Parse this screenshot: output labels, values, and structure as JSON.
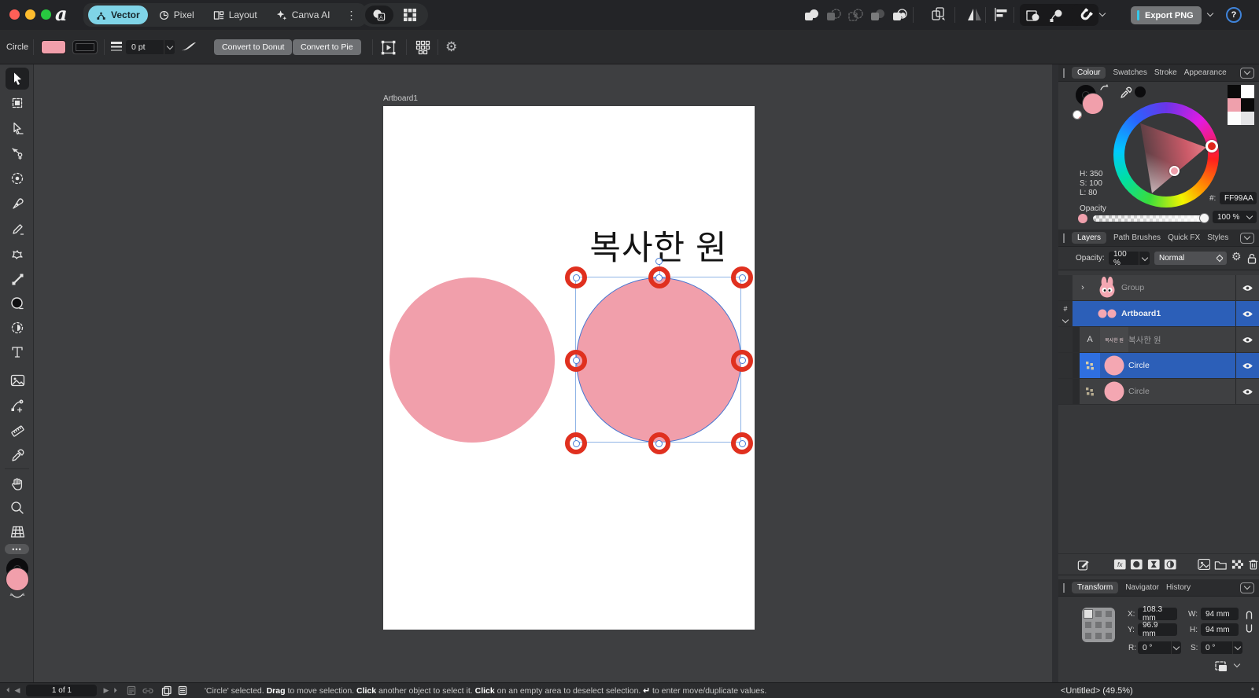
{
  "titlebar": {
    "logo": "a",
    "personas": [
      {
        "label": "Vector"
      },
      {
        "label": "Pixel"
      },
      {
        "label": "Layout"
      },
      {
        "label": "Canva AI"
      }
    ],
    "export_label": "Export PNG"
  },
  "icons": {
    "more_vertical": "⋮",
    "help": "?",
    "more_dots": "•••",
    "artboard_badge": "#",
    "text_layer_badge": "A",
    "fx": "fx",
    "modified_star": "*",
    "hash_hex_prefix": "#:"
  },
  "context_toolbar": {
    "tool_label": "Circle",
    "stroke_width": "0 pt",
    "convert_to_donut": "Convert to Donut",
    "convert_to_pie": "Convert to Pie",
    "fill_color": "#F19FAB"
  },
  "canvas": {
    "artboard_label": "Artboard1",
    "text_object": "복사한 원",
    "circle_fill": "#F19FAB",
    "selection_blue": "#4A7CD6",
    "handle_ring_red": "#E0301F"
  },
  "colour_panel": {
    "tabs": {
      "colour": "Colour",
      "swatches": "Swatches",
      "stroke": "Stroke",
      "appearance": "Appearance"
    },
    "h": "H: 350",
    "s": "S: 100",
    "l": "L: 80",
    "hex_prefix": "#:",
    "hex": "FF99AA",
    "opacity_label": "Opacity",
    "opacity_value": "100 %"
  },
  "layers_panel": {
    "tabs": {
      "layers": "Layers",
      "path_brushes": "Path Brushes",
      "quick_fx": "Quick FX",
      "styles": "Styles"
    },
    "opacity_label": "Opacity:",
    "opacity_value": "100 %",
    "blend_mode": "Normal",
    "rows": [
      {
        "label": "Group"
      },
      {
        "label": "Artboard1"
      },
      {
        "label": "복사한 원"
      },
      {
        "label": "Circle"
      },
      {
        "label": "Circle"
      }
    ]
  },
  "transform_panel": {
    "tabs": {
      "transform": "Transform",
      "navigator": "Navigator",
      "history": "History"
    },
    "x_label": "X:",
    "x_value": "108.3 mm",
    "y_label": "Y:",
    "y_value": "96.9 mm",
    "w_label": "W:",
    "w_value": "94 mm",
    "h_label": "H:",
    "h_value": "94 mm",
    "r_label": "R:",
    "r_value": "0 °",
    "s_label": "S:",
    "s_value": "0 °"
  },
  "status_bar": {
    "page": "1 of 1",
    "hint": {
      "t1": "'Circle' selected. ",
      "b1": "Drag",
      "t2": " to move selection. ",
      "b2": "Click",
      "t3": " another object to select it. ",
      "b3": "Click",
      "t4": " on an empty area to deselect selection. ",
      "b4": "↵",
      "t5": " to enter move/duplicate values."
    },
    "document": "<Untitled> (49.5%)"
  }
}
